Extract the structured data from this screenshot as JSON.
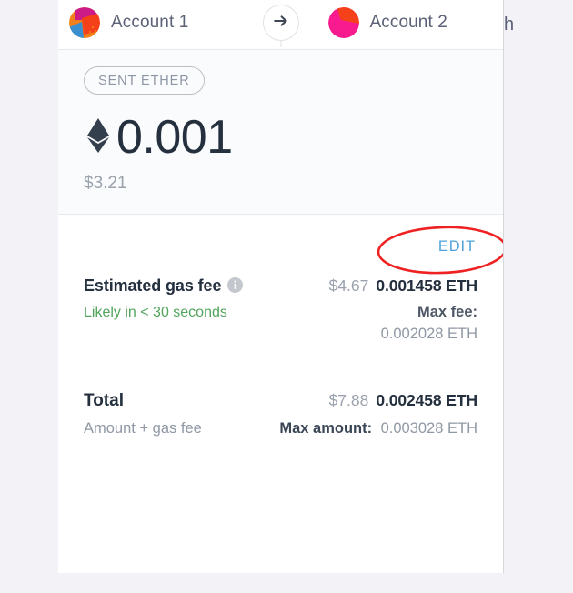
{
  "window": {
    "background_color": "#f2f2f7",
    "panel_background": "#ffffff",
    "stray_text": "h"
  },
  "header": {
    "from_account": {
      "name": "Account 1",
      "avatar_name": "jazzicon-account-1"
    },
    "to_account": {
      "name": "Account 2",
      "avatar_name": "jazzicon-account-2"
    },
    "arrow_icon": "arrow-right-icon"
  },
  "amount_section": {
    "badge_label": "SENT ETHER",
    "currency_symbol": "♦",
    "amount": "0.001",
    "fiat_amount": "$3.21"
  },
  "details": {
    "edit_label": "EDIT",
    "gas_fee": {
      "label": "Estimated gas fee",
      "info_icon": "info-icon",
      "fiat": "$4.67",
      "eth": "0.001458 ETH",
      "speed_text": "Likely in < 30 seconds",
      "speed_color": "#53a45c",
      "max_fee_label": "Max fee:",
      "max_fee_value": "0.002028 ETH"
    },
    "total": {
      "label": "Total",
      "fiat": "$7.88",
      "eth": "0.002458 ETH",
      "description": "Amount + gas fee",
      "max_amount_label": "Max amount:",
      "max_amount_value": "0.003028 ETH"
    }
  },
  "annotation": {
    "shape": "red-ellipse",
    "color": "#ee2222",
    "target": "EDIT"
  },
  "colors": {
    "accent_link": "#4fa3d8",
    "text_primary": "#25303f",
    "text_muted": "#9aa2ad",
    "success": "#53a45c",
    "annotation_red": "#ee2222"
  }
}
